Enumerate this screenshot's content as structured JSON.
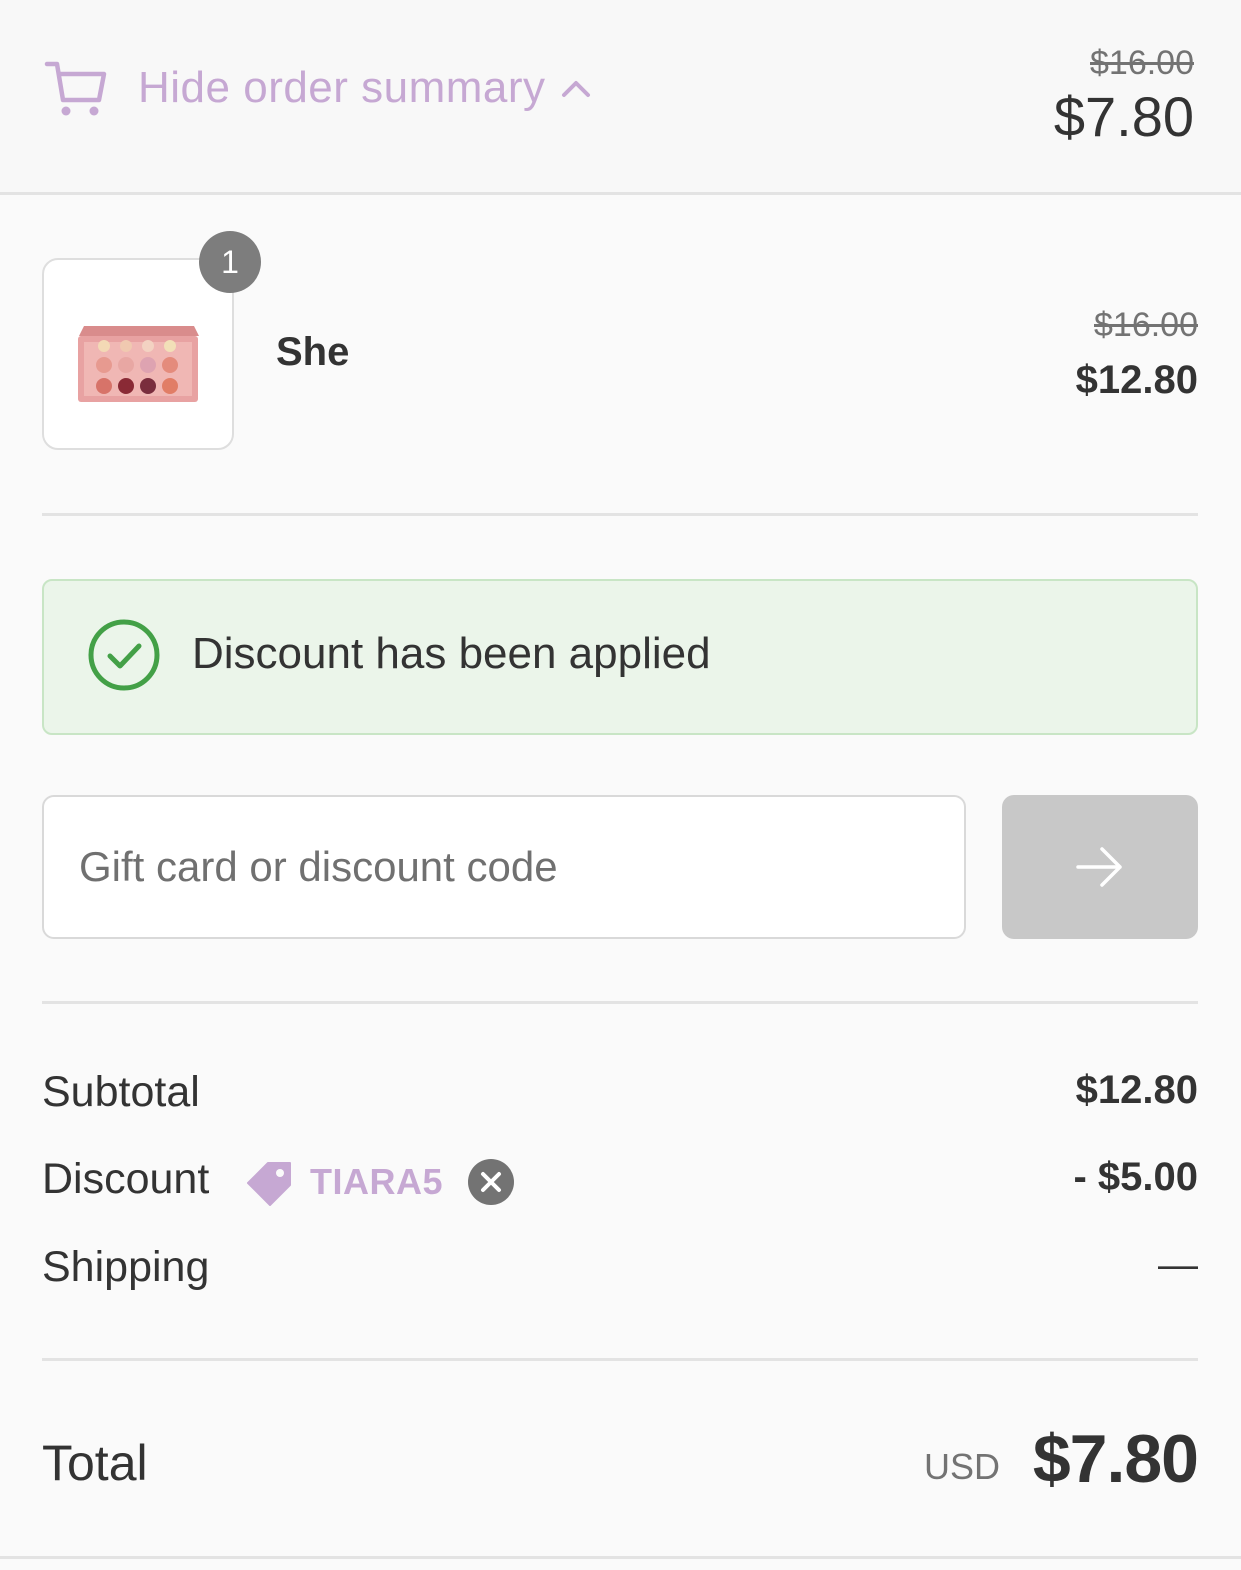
{
  "header": {
    "toggle_label": "Hide order summary",
    "original_price": "$16.00",
    "price": "$7.80",
    "accent_color": "#c6a8d3"
  },
  "line_item": {
    "quantity": "1",
    "name": "She",
    "original_price": "$16.00",
    "price": "$12.80",
    "image_icon": "eyeshadow-palette"
  },
  "banner": {
    "message": "Discount has been applied",
    "color": "#43a047"
  },
  "discount_form": {
    "placeholder": "Gift card or discount code",
    "value": ""
  },
  "summary": {
    "subtotal_label": "Subtotal",
    "subtotal_value": "$12.80",
    "discount_label": "Discount",
    "discount_code": "TIARA5",
    "discount_value": "- $5.00",
    "shipping_label": "Shipping",
    "shipping_value": "—"
  },
  "total": {
    "label": "Total",
    "currency": "USD",
    "amount": "$7.80"
  }
}
